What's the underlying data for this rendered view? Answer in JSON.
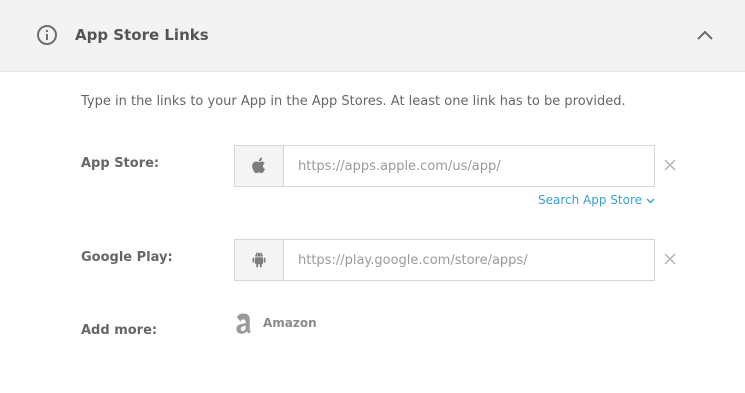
{
  "header": {
    "title": "App Store Links",
    "info_icon": "info-circle-icon",
    "collapse_icon": "chevron-up-icon"
  },
  "intro": "Type in the links to your App in the App Stores. At least one link has to be provided.",
  "app_store": {
    "label": "App Store:",
    "icon": "apple-icon",
    "value": "",
    "placeholder": "https://apps.apple.com/us/app/",
    "clear_icon": "close-icon",
    "search_link": "Search App Store",
    "search_link_icon": "chevron-down-icon"
  },
  "google_play": {
    "label": "Google Play:",
    "icon": "android-icon",
    "value": "",
    "placeholder": "https://play.google.com/store/apps/",
    "clear_icon": "close-icon"
  },
  "add_more": {
    "label": "Add more:",
    "options": [
      {
        "name": "Amazon",
        "icon": "amazon-icon"
      }
    ]
  },
  "colors": {
    "header_bg": "#f3f3f3",
    "link": "#3aa0d1",
    "text": "#555555",
    "border": "#d6d6d6"
  }
}
